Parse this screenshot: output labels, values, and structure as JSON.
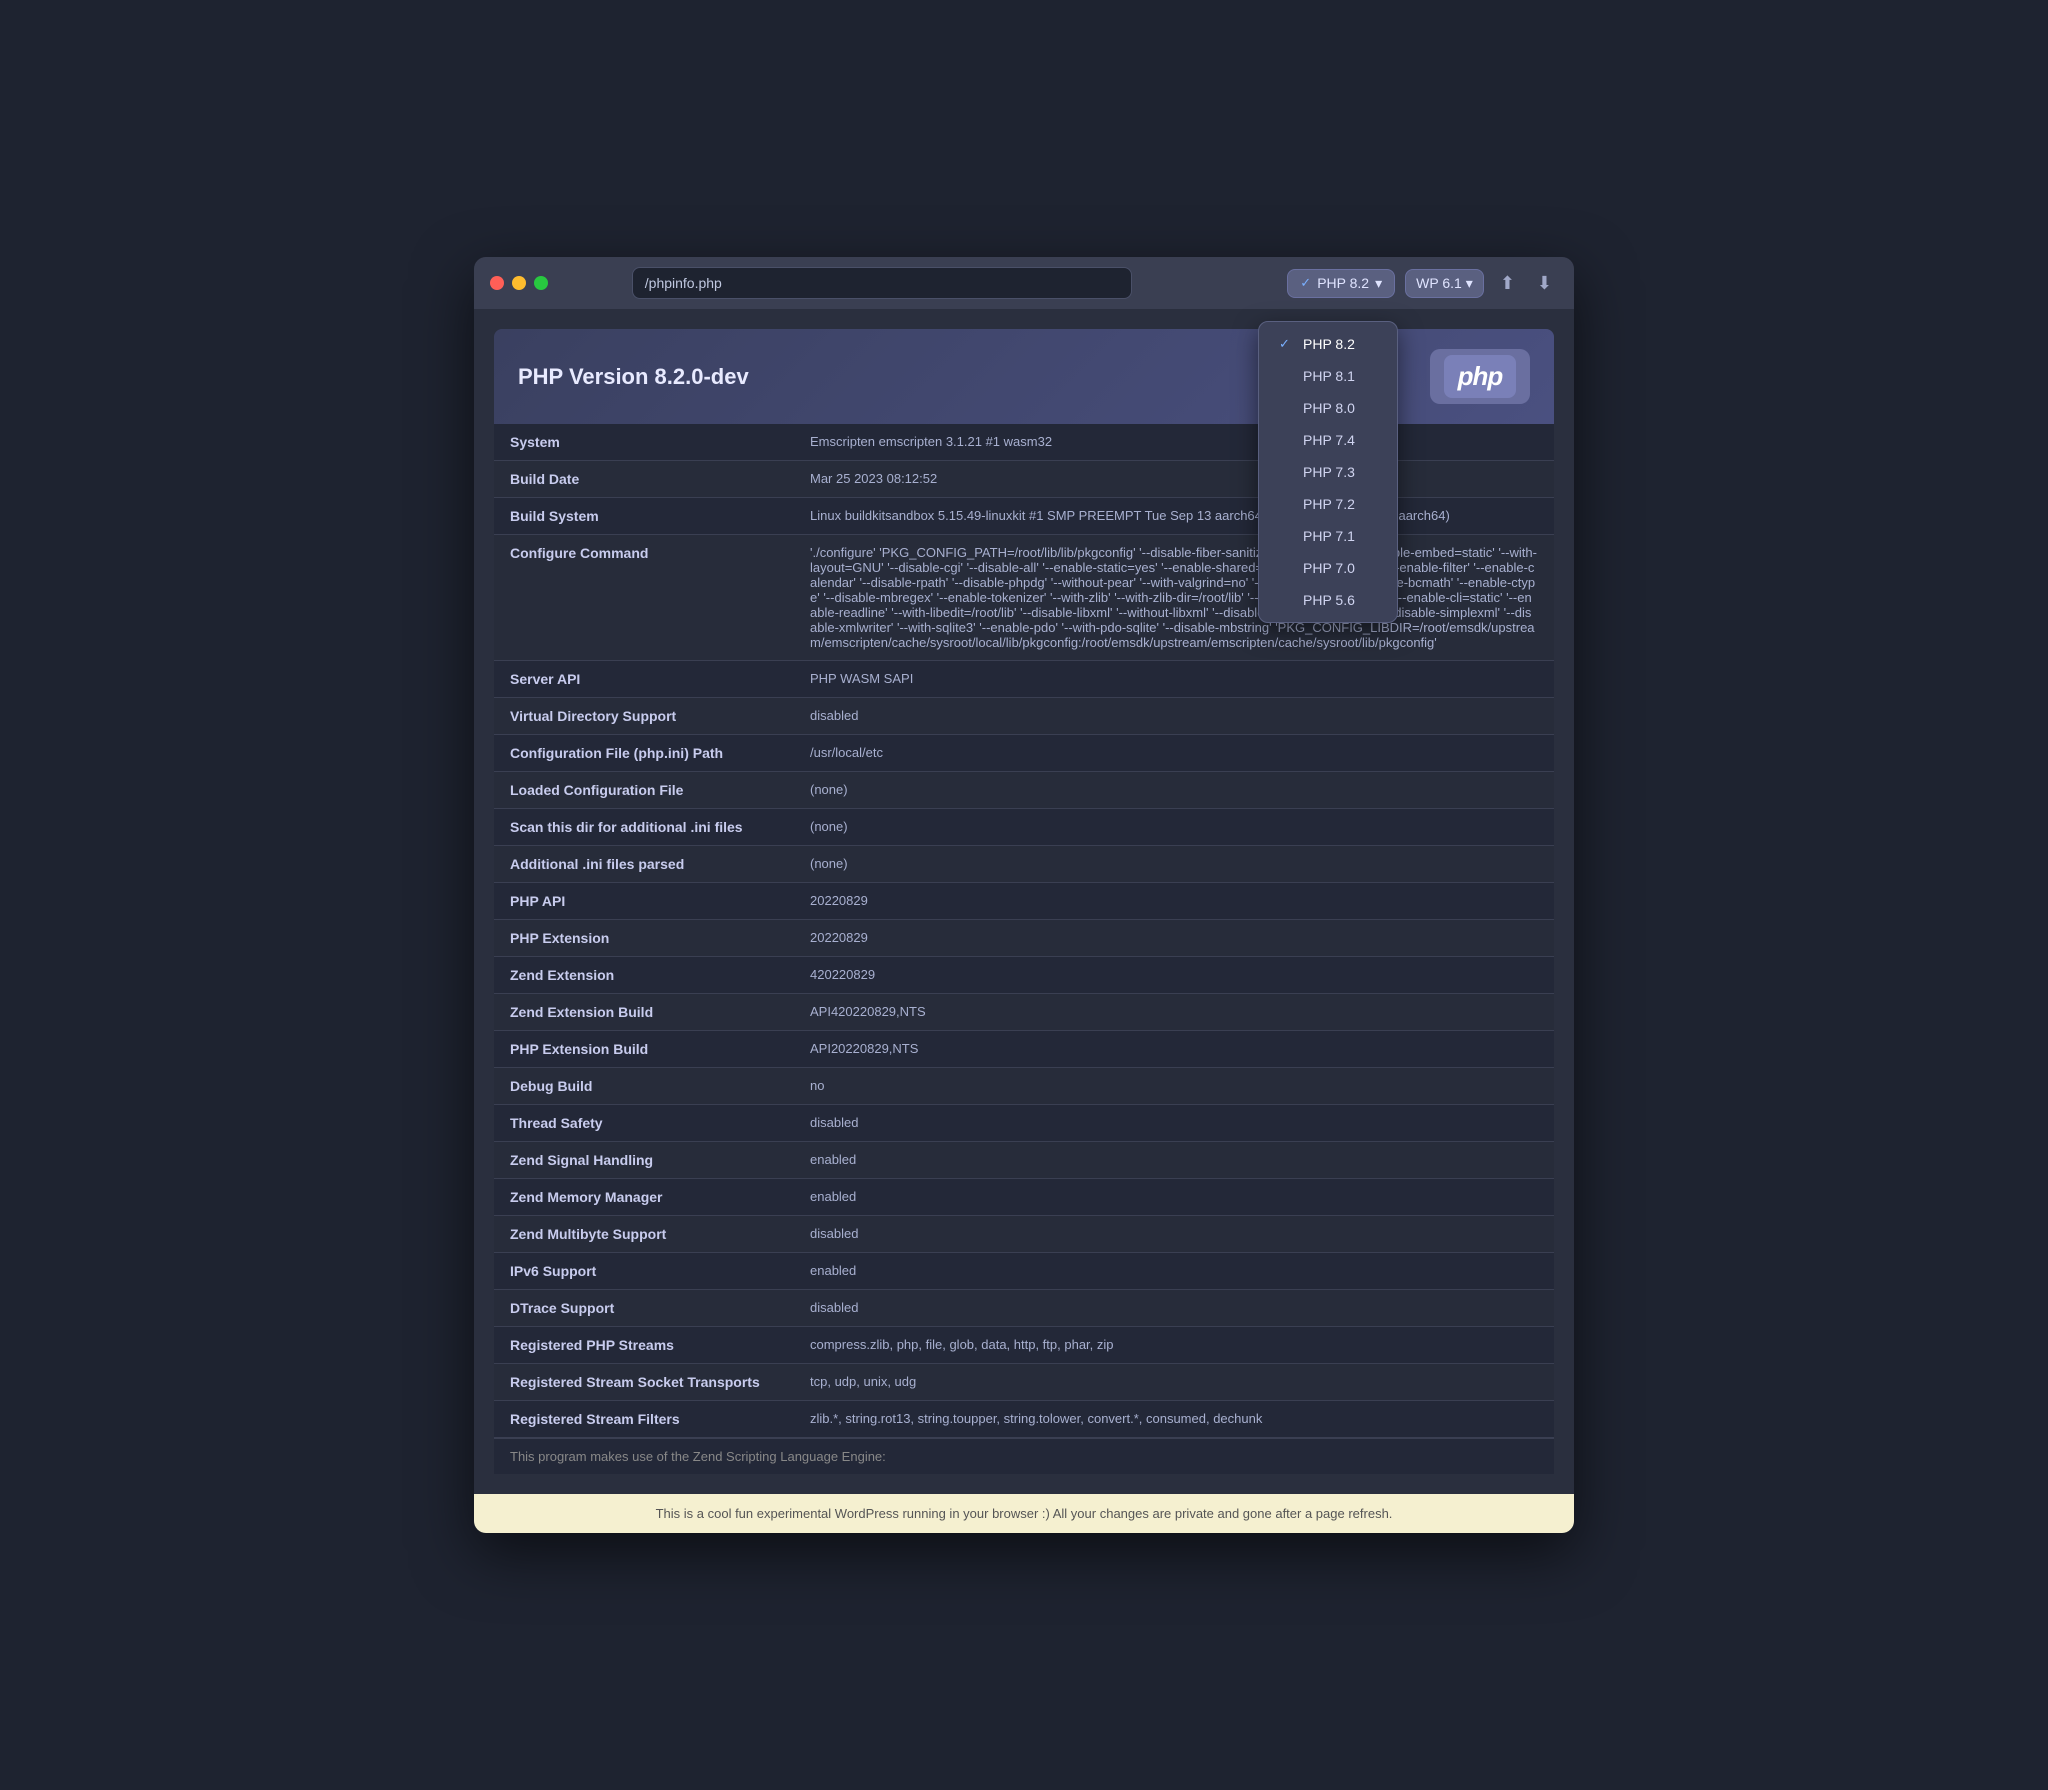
{
  "window": {
    "address": "/phpinfo.php"
  },
  "php_version_dropdown": {
    "selected": "PHP 8.2",
    "options": [
      {
        "label": "PHP 8.2",
        "selected": true
      },
      {
        "label": "PHP 8.1",
        "selected": false
      },
      {
        "label": "PHP 8.0",
        "selected": false
      },
      {
        "label": "PHP 7.4",
        "selected": false
      },
      {
        "label": "PHP 7.3",
        "selected": false
      },
      {
        "label": "PHP 7.2",
        "selected": false
      },
      {
        "label": "PHP 7.1",
        "selected": false
      },
      {
        "label": "PHP 7.0",
        "selected": false
      },
      {
        "label": "PHP 5.6",
        "selected": false
      }
    ]
  },
  "wp_version": {
    "label": "WP 6.1"
  },
  "php_header": {
    "title": "PHP Version 8.2.0-dev",
    "logo_text": "php"
  },
  "table_rows": [
    {
      "key": "System",
      "value": "Emscripten emscripten 3.1.21 #1 wasm32"
    },
    {
      "key": "Build Date",
      "value": "Mar 25 2023 08:12:52"
    },
    {
      "key": "Build System",
      "value": "Linux buildkitsandbox 5.15.49-linuxkit #1 SMP PREEMPT Tue Sep 13 aarch64 GNU/Linux (2 aarch64 aarch64)"
    },
    {
      "key": "Configure Command",
      "value": "'./configure' 'PKG_CONFIG_PATH=/root/lib/lib/pkgconfig' '--disable-fiber-sanitize' '--enable-json' '--enable-embed=static' '--with-layout=GNU' '--disable-cgi' '--disable-all' '--enable-static=yes' '--enable-shared=no' '--enable-session' '--enable-filter' '--enable-calendar' '--disable-rpath' '--disable-phpdg' '--without-pear' '--with-valgrind=no' '--without-pcre-jit' '--enable-bcmath' '--enable-ctype' '--disable-mbregex' '--enable-tokenizer' '--with-zlib' '--with-zlib-dir=/root/lib' '--with-zip' '--enable-phar' '--enable-cli=static' '--enable-readline' '--with-libedit=/root/lib' '--disable-libxml' '--without-libxml' '--disable-dom' '--disable-xml' '--disable-simplexml' '--disable-xmlwriter' '--with-sqlite3' '--enable-pdo' '--with-pdo-sqlite' '--disable-mbstring' 'PKG_CONFIG_LIBDIR=/root/emsdk/upstream/emscripten/cache/sysroot/local/lib/pkgconfig:/root/emsdk/upstream/emscripten/cache/sysroot/lib/pkgconfig'"
    },
    {
      "key": "Server API",
      "value": "PHP WASM SAPI"
    },
    {
      "key": "Virtual Directory Support",
      "value": "disabled"
    },
    {
      "key": "Configuration File (php.ini) Path",
      "value": "/usr/local/etc"
    },
    {
      "key": "Loaded Configuration File",
      "value": "(none)"
    },
    {
      "key": "Scan this dir for additional .ini files",
      "value": "(none)"
    },
    {
      "key": "Additional .ini files parsed",
      "value": "(none)"
    },
    {
      "key": "PHP API",
      "value": "20220829"
    },
    {
      "key": "PHP Extension",
      "value": "20220829"
    },
    {
      "key": "Zend Extension",
      "value": "420220829"
    },
    {
      "key": "Zend Extension Build",
      "value": "API420220829,NTS"
    },
    {
      "key": "PHP Extension Build",
      "value": "API20220829,NTS"
    },
    {
      "key": "Debug Build",
      "value": "no"
    },
    {
      "key": "Thread Safety",
      "value": "disabled"
    },
    {
      "key": "Zend Signal Handling",
      "value": "enabled"
    },
    {
      "key": "Zend Memory Manager",
      "value": "enabled"
    },
    {
      "key": "Zend Multibyte Support",
      "value": "disabled"
    },
    {
      "key": "IPv6 Support",
      "value": "enabled"
    },
    {
      "key": "DTrace Support",
      "value": "disabled"
    },
    {
      "key": "Registered PHP Streams",
      "value": "compress.zlib, php, file, glob, data, http, ftp, phar, zip"
    },
    {
      "key": "Registered Stream Socket Transports",
      "value": "tcp, udp, unix, udg"
    },
    {
      "key": "Registered Stream Filters",
      "value": "zlib.*, string.rot13, string.toupper, string.tolower, convert.*, consumed, dechunk"
    }
  ],
  "footer": {
    "text": "This is a cool fun experimental WordPress running in your browser :) All your changes are private and gone after a page refresh."
  },
  "zend_footer_text": "This program makes use of the Zend Scripting Language Engine:"
}
